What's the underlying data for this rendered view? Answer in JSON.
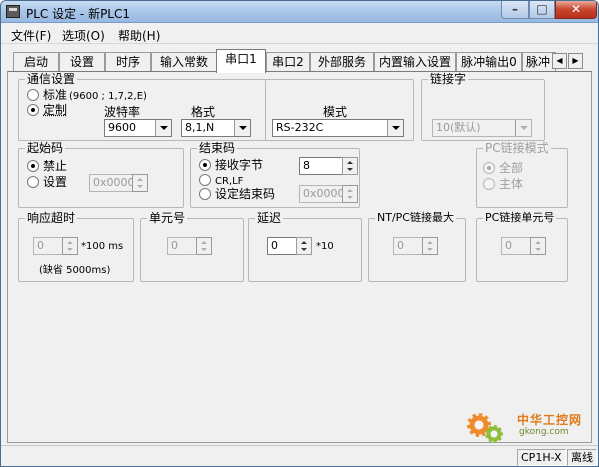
{
  "window": {
    "title": "PLC 设定 - 新PLC1",
    "min": "–",
    "max": "□",
    "close": "✕"
  },
  "menu": [
    {
      "label": "文件(F)"
    },
    {
      "label": "选项(O)"
    },
    {
      "label": "帮助(H)"
    }
  ],
  "tabs": [
    {
      "label": "启动"
    },
    {
      "label": "设置"
    },
    {
      "label": "时序"
    },
    {
      "label": "输入常数"
    },
    {
      "label": "串口1"
    },
    {
      "label": "串口2"
    },
    {
      "label": "外部服务"
    },
    {
      "label": "内置输入设置"
    },
    {
      "label": "脉冲输出0"
    },
    {
      "label": "脉冲"
    }
  ],
  "tab_scroll": {
    "left": "◀",
    "right": "▶"
  },
  "comm": {
    "legend": "通信设置",
    "standard": "标准",
    "standard_detail": "(9600 ; 1,7,2,E)",
    "custom": "定制",
    "baud_label": "波特率",
    "baud_value": "9600",
    "format_label": "格式",
    "format_value": "8,1,N",
    "mode_label": "模式",
    "mode_value": "RS-232C"
  },
  "link_word": {
    "legend": "链接字",
    "value": "10(默认)"
  },
  "start_code": {
    "legend": "起始码",
    "disable": "禁止",
    "set": "设置",
    "value": "0x0000"
  },
  "end_code": {
    "legend": "结束码",
    "received_bytes": "接收字节",
    "received_value": "8",
    "crlf": "CR,LF",
    "set_end": "设定结束码",
    "end_value": "0x0000"
  },
  "pc_link_mode": {
    "legend": "PC链接模式",
    "all": "全部",
    "master": "主体"
  },
  "response_timeout": {
    "legend": "响应超时",
    "value": "0",
    "unit": "*100 ms",
    "default": "(缺省 5000ms)"
  },
  "unit_no": {
    "legend": "单元号",
    "value": "0"
  },
  "delay": {
    "legend": "延迟",
    "value": "0",
    "unit": "*10"
  },
  "nt_pc_link_max": {
    "legend": "NT/PC链接最大",
    "value": "0"
  },
  "pc_link_unit_no": {
    "legend": "PC链接单元号",
    "value": "0"
  },
  "status": {
    "model": "CP1H-X",
    "state": "离线"
  },
  "watermark": {
    "name": "中华工控网",
    "url": "gkong.com"
  }
}
